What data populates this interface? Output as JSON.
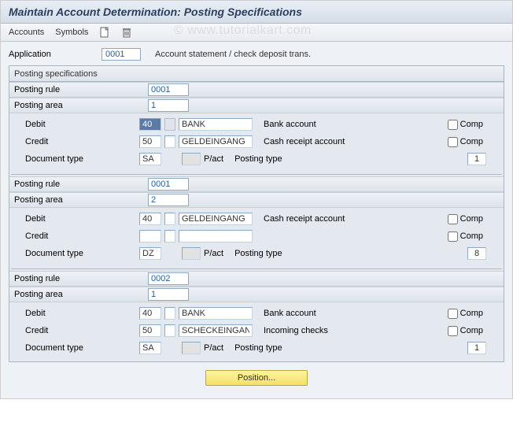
{
  "title": "Maintain Account Determination: Posting Specifications",
  "toolbar": {
    "accounts": "Accounts",
    "symbols": "Symbols"
  },
  "watermark": "© www.tutorialkart.com",
  "application": {
    "label": "Application",
    "value": "0001",
    "desc": "Account statement / check deposit trans."
  },
  "group_title": "Posting specifications",
  "labels": {
    "posting_rule": "Posting rule",
    "posting_area": "Posting area",
    "debit": "Debit",
    "credit": "Credit",
    "doc_type": "Document type",
    "pact": "P/act",
    "posting_type": "Posting type",
    "comp": "Comp"
  },
  "blocks": [
    {
      "rule": "0001",
      "area": "1",
      "debit": {
        "key": "40",
        "acct": "BANK",
        "desc": "Bank account",
        "comp": false,
        "key_selected": true
      },
      "credit": {
        "key": "50",
        "acct": "GELDEINGANG",
        "desc": "Cash receipt account",
        "comp": false
      },
      "doc": {
        "type": "SA",
        "pact": "",
        "ptype": "1"
      }
    },
    {
      "rule": "0001",
      "area": "2",
      "debit": {
        "key": "40",
        "acct": "GELDEINGANG",
        "desc": "Cash receipt account",
        "comp": false
      },
      "credit": {
        "key": "",
        "acct": "",
        "desc": "",
        "comp": false
      },
      "doc": {
        "type": "DZ",
        "pact": "",
        "ptype": "8"
      }
    },
    {
      "rule": "0002",
      "area": "1",
      "debit": {
        "key": "40",
        "acct": "BANK",
        "desc": "Bank account",
        "comp": false
      },
      "credit": {
        "key": "50",
        "acct": "SCHECKEINGANG",
        "desc": "Incoming checks",
        "comp": false
      },
      "doc": {
        "type": "SA",
        "pact": "",
        "ptype": "1"
      }
    }
  ],
  "footer": {
    "position_btn": "Position..."
  }
}
